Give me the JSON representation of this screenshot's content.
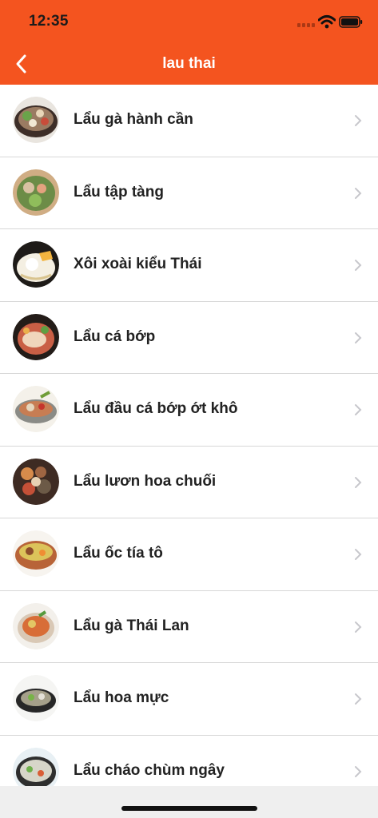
{
  "status_bar": {
    "time": "12:35",
    "icons": [
      "signal-icon",
      "wifi-icon",
      "battery-icon"
    ]
  },
  "nav": {
    "title": "lau thai",
    "back_icon": "chevron-left-icon"
  },
  "colors": {
    "header": "#f4541f",
    "text": "#222222",
    "divider": "#d7d7d7",
    "chevron": "#c7c7cc"
  },
  "list": {
    "items": [
      {
        "label": "Lẩu gà hành cần"
      },
      {
        "label": "Lẩu tập tàng"
      },
      {
        "label": "Xôi xoài kiểu Thái"
      },
      {
        "label": "Lẩu cá bớp"
      },
      {
        "label": "Lẩu đầu cá bớp ớt khô"
      },
      {
        "label": "Lẩu lươn hoa chuối"
      },
      {
        "label": "Lẩu ốc tía tô"
      },
      {
        "label": "Lẩu gà Thái Lan"
      },
      {
        "label": "Lẩu hoa mực"
      },
      {
        "label": "Lẩu cháo chùm ngây"
      }
    ]
  }
}
